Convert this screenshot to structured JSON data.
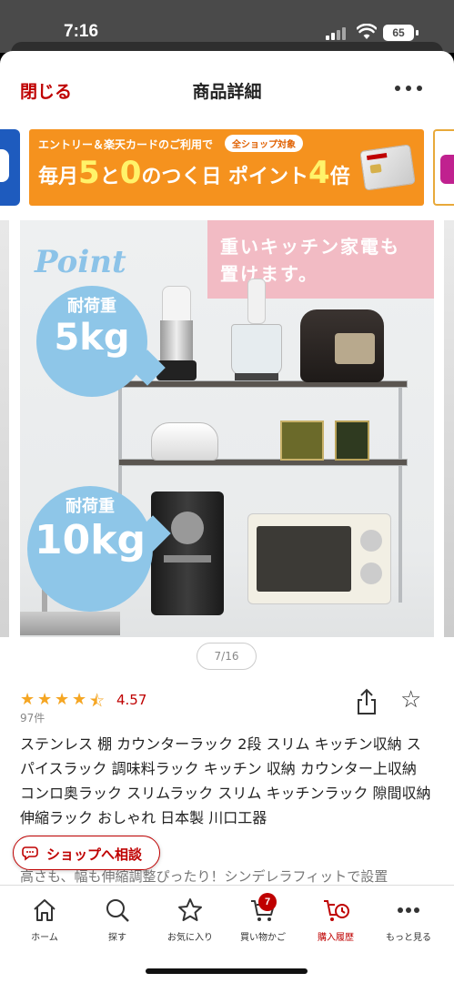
{
  "status_bar": {
    "time": "7:16",
    "battery": "65"
  },
  "header": {
    "close_label": "閉じる",
    "title": "商品詳細"
  },
  "promo_banner": {
    "line1": "エントリー＆楽天カードのご利用で",
    "badge": "全ショップ対象",
    "line2_prefix": "毎月",
    "num1": "5",
    "mid": "と",
    "num2": "0",
    "suffix": "のつく日 ポイント",
    "multiplier": "4",
    "unit": "倍"
  },
  "product_image": {
    "heading_line1": "重いキッチン家電も",
    "heading_line2": "置けます。",
    "point_label": "Point",
    "upper_load_title": "耐荷重",
    "upper_load_value": "5kg",
    "lower_load_title": "耐荷重",
    "lower_load_value": "10kg"
  },
  "gallery_pager": "7/16",
  "rating": {
    "value": "4.57",
    "stars": 4.5,
    "review_count": "97件"
  },
  "product": {
    "title": "ステンレス 棚 カウンターラック 2段 スリム キッチン収納 スパイスラック 調味料ラック キッチン 収納 カウンター上収納 コンロ奥ラック スリムラック スリム キッチンラック 隙間収納 伸縮ラック おしゃれ 日本製 川口工器",
    "subtitle": "高さも、幅も伸縮調整ぴったり！シンデレラフィットで設置"
  },
  "consult_button": "ショップへ相談",
  "bottom_nav": {
    "items": [
      {
        "label": "ホーム",
        "icon": "home-icon"
      },
      {
        "label": "探す",
        "icon": "search-icon"
      },
      {
        "label": "お気に入り",
        "icon": "star-icon"
      },
      {
        "label": "買い物かご",
        "icon": "cart-icon"
      },
      {
        "label": "購入履歴",
        "icon": "history-icon"
      },
      {
        "label": "もっと見る",
        "icon": "more-icon"
      }
    ],
    "cart_count": "7",
    "active_item": "購入履歴"
  },
  "colors": {
    "accent": "#bf0000",
    "banner": "#f5921e",
    "star": "#f5a623",
    "bubble": "#8ec6e8"
  }
}
